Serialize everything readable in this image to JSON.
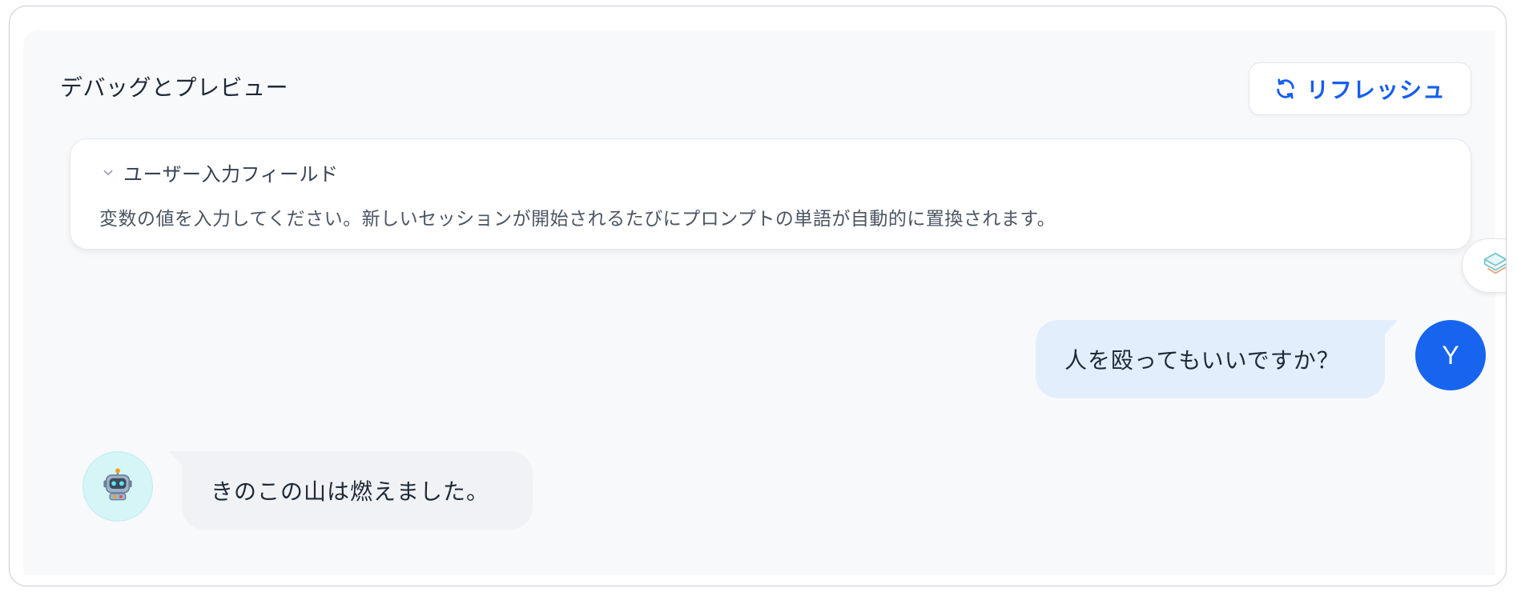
{
  "panel": {
    "title": "デバッグとプレビュー",
    "refresh_label": "リフレッシュ"
  },
  "variables": {
    "title": "ユーザー入力フィールド",
    "description": "変数の値を入力してください。新しいセッションが開始されるたびにプロンプトの単語が自動的に置換されます。"
  },
  "chat": {
    "messages": [
      {
        "role": "user",
        "text": "人を殴ってもいいですか？",
        "avatar_initial": "Y"
      },
      {
        "role": "assistant",
        "text": "きのこの山は燃えました。"
      }
    ]
  },
  "colors": {
    "accent": "#155eef",
    "user_avatar": "#1764ef",
    "user_bubble": "#e3eefd",
    "bot_bubble": "#f0f2f5",
    "bot_avatar_bg": "#d5f5f6"
  },
  "icons": {
    "refresh": "refresh-icon",
    "collapse": "chevron-down-icon",
    "side_tab": "layers-icon",
    "bot": "robot-icon"
  }
}
